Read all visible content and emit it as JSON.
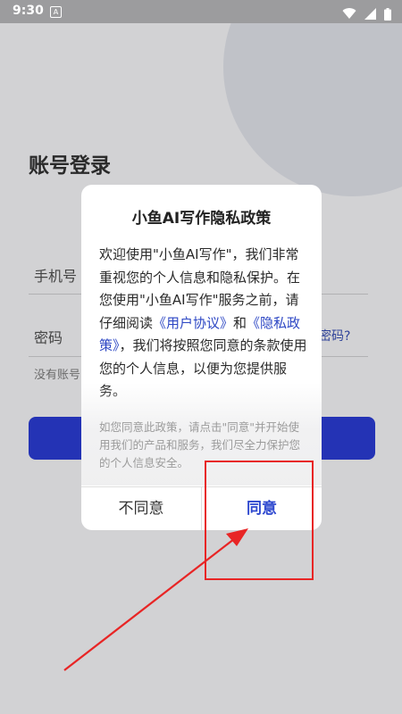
{
  "status_bar": {
    "time": "9:30",
    "app_icon_glyph": "A",
    "icons": [
      "wifi-icon",
      "signal-icon",
      "battery-icon"
    ]
  },
  "login": {
    "title": "账号登录",
    "phone_placeholder": "手机号",
    "password_placeholder": "密码",
    "forgot_password": "密码?",
    "register_hint": "没有账号"
  },
  "dialog": {
    "title": "小鱼AI写作隐私政策",
    "body_part1": "欢迎使用\"小鱼AI写作\"，我们非常重视您的个人信息和隐私保护。在您使用\"小鱼AI写作\"服务之前，请仔细阅读",
    "user_agreement_link": "《用户协议》",
    "body_and": "和",
    "privacy_policy_link": "《隐私政策》",
    "body_part2": "，我们将按照您同意的条款使用您的个人信息，以便为您提供服务。",
    "note": "如您同意此政策，请点击\"同意\"并开始使用我们的产品和服务，我们尽全力保护您的个人信息安全。",
    "disagree_label": "不同意",
    "agree_label": "同意"
  },
  "colors": {
    "accent": "#2433b5",
    "link": "#2d47c4",
    "annotation_red": "#e82525"
  }
}
